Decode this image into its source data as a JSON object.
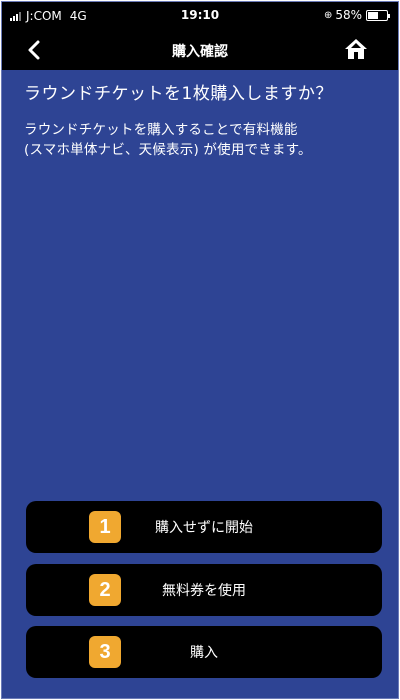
{
  "status_bar": {
    "carrier": "J:COM",
    "network": "4G",
    "time": "19:10",
    "battery_percent": "58%",
    "battery_level": 0.58
  },
  "nav": {
    "title": "購入確認",
    "back_icon": "chevron-left-icon",
    "home_icon": "home-icon"
  },
  "content": {
    "question": "ラウンドチケットを1枚購入しますか？",
    "description_line1": "ラウンドチケットを購入することで有料機能",
    "description_line2": "(スマホ単体ナビ、天候表示) が使用できます。"
  },
  "buttons": [
    {
      "badge": "1",
      "label": "購入せずに開始"
    },
    {
      "badge": "2",
      "label": "無料券を使用"
    },
    {
      "badge": "3",
      "label": "購入"
    }
  ],
  "colors": {
    "background": "#2e4494",
    "bars": "#000000",
    "badge": "#f0a830"
  }
}
